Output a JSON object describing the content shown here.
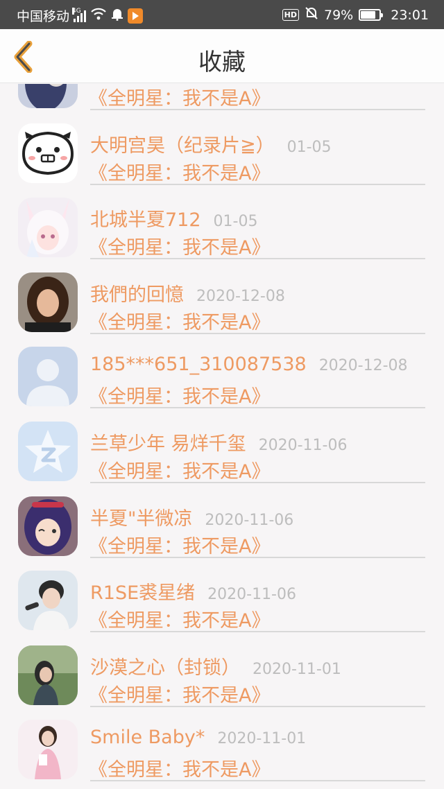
{
  "status_bar": {
    "carrier": "中国移动",
    "network": "4G",
    "battery_percent": "79%",
    "battery_level": 0.79,
    "time": "23:01",
    "hd_label": "HD",
    "icons": [
      "signal-icon",
      "wifi-icon",
      "notification-bell-icon",
      "app-badge-icon",
      "hd-icon",
      "mute-bell-icon",
      "battery-icon"
    ]
  },
  "nav": {
    "title": "收藏",
    "back_icon": "chevron-left-icon",
    "accent": "#e8a03a"
  },
  "colors": {
    "name": "#ee9a62",
    "date": "#bdbdbd"
  },
  "items": [
    {
      "name": "",
      "date": "",
      "title": "《全明星：我不是A》",
      "avatar": "partial-photo"
    },
    {
      "name": "大明宫昊（纪录片≧）",
      "date": "01-05",
      "title": "《全明星：我不是A》",
      "avatar": "cartoon-face"
    },
    {
      "name": "北城半夏712",
      "date": "01-05",
      "title": "《全明星：我不是A》",
      "avatar": "anime-bunny-girl"
    },
    {
      "name": "我們的回憶",
      "date": "2020-12-08",
      "title": "《全明星：我不是A》",
      "avatar": "woman-portrait"
    },
    {
      "name": "185***651_310087538",
      "date": "2020-12-08",
      "title": "《全明星：我不是A》",
      "avatar": "default-user"
    },
    {
      "name": "兰草少年 易烊千玺",
      "date": "2020-11-06",
      "title": "《全明星：我不是A》",
      "avatar": "qq-star"
    },
    {
      "name": "半夏\"半微凉",
      "date": "2020-11-06",
      "title": "《全明星：我不是A》",
      "avatar": "anime-girl"
    },
    {
      "name": "R1SE裘星绪",
      "date": "2020-11-06",
      "title": "《全明星：我不是A》",
      "avatar": "singer-portrait"
    },
    {
      "name": "沙漠之心（封锁）",
      "date": "2020-11-01",
      "title": "《全明星：我不是A》",
      "avatar": "outdoor-girl"
    },
    {
      "name": "Smile Baby*",
      "date": "2020-11-01",
      "title": "《全明星：我不是A》",
      "avatar": "pink-dress-girl"
    }
  ]
}
